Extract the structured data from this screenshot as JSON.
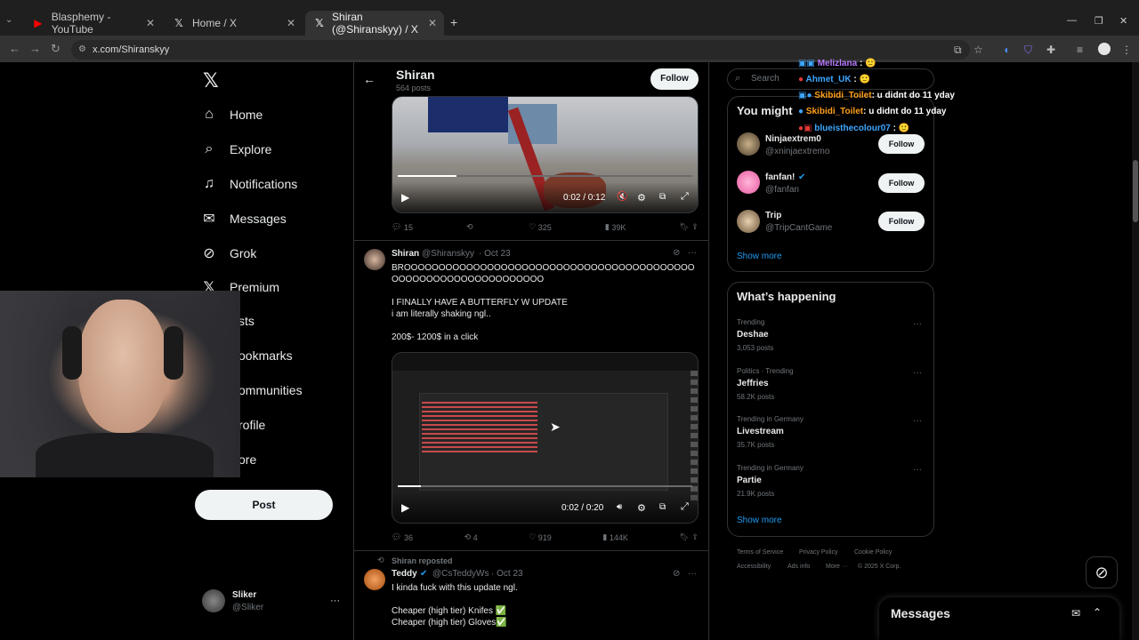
{
  "browser": {
    "tabs": [
      {
        "title": "Blasphemy - YouTube",
        "icon": "youtube-icon"
      },
      {
        "title": "Home / X",
        "icon": "x-logo-icon"
      },
      {
        "title": "Shiran (@Shiranskyy) / X",
        "icon": "x-logo-icon"
      }
    ],
    "url": "x.com/Shiranskyy",
    "new_tab": "+"
  },
  "nav": {
    "items": [
      "Home",
      "Explore",
      "Notifications",
      "Messages",
      "Grok",
      "Premium",
      "sts",
      "ookmarks",
      "ommunities",
      "rofile",
      "ore"
    ],
    "post_label": "Post",
    "account_name": "Sliker",
    "account_handle": "@Sliker"
  },
  "profile_header": {
    "name": "Shiran",
    "posts": "564 posts",
    "follow_label": "Follow"
  },
  "tweets": [
    {
      "video_time": "0:02 / 0:12",
      "video_progress": 0.2,
      "replies": "15",
      "retweets": "",
      "likes": "325",
      "views": "39K"
    },
    {
      "author": "Shiran",
      "handle": "@Shiranskyy",
      "date": "· Oct 23",
      "text": "BROOOOOOOOOOOOOOOOOOOOOOOOOOOOOOOOOOOOOOOOOOOOOOOOOOOOOOOOOOOOOOOO\n\nI FINALLY HAVE A BUTTERFLY W UPDATE\ni am literally shaking ngl..\n\n200$- 1200$ in a click",
      "video_time": "0:02 / 0:20",
      "video_progress": 0.08,
      "replies": "36",
      "retweets": "4",
      "likes": "919",
      "views": "144K"
    },
    {
      "repost_label": "Shiran reposted",
      "author": "Teddy",
      "handle": "@CsTeddyWs",
      "date": "· Oct 23",
      "text": "I kinda fuck with this update ngl.\n\nCheaper (high tier) Knifes ✅\nCheaper (high tier) Gloves✅"
    }
  ],
  "search": {
    "placeholder": "Search"
  },
  "who_to_follow": {
    "title": "You might",
    "users": [
      {
        "name": "Ninjaextrem0",
        "handle": "@xninjaextremo"
      },
      {
        "name": "fanfan!",
        "handle": "@fanfan"
      },
      {
        "name": "Trip",
        "handle": "@TripCantGame"
      }
    ],
    "follow_label": "Follow",
    "show_more": "Show more"
  },
  "whats_happening": {
    "title": "What’s happening",
    "trends": [
      {
        "meta": "Trending",
        "name": "Deshae",
        "count": "3,053 posts"
      },
      {
        "meta": "Politics · Trending",
        "name": "Jeffries",
        "count": "58.2K posts"
      },
      {
        "meta": "Trending in Germany",
        "name": "Livestream",
        "count": "35.7K posts"
      },
      {
        "meta": "Trending in Germany",
        "name": "Partie",
        "count": "21.9K posts"
      }
    ],
    "show_more": "Show more"
  },
  "footer": {
    "links": [
      "Terms of Service",
      "Privacy Policy",
      "Cookie Policy",
      "Accessibility",
      "Ads info",
      "More ···",
      "© 2025 X Corp."
    ]
  },
  "chat_overlay": [
    {
      "user": "Melizlana",
      "message": ":",
      "color": "#b77bff"
    },
    {
      "user": "Ahmet_UK",
      "message": ":",
      "color": "#3ea6ff"
    },
    {
      "user": "Skibidi_Toilet",
      "message": ": u didnt do 11 yday",
      "color": "#ff9f1a"
    },
    {
      "user": "Skibidi_Toilet",
      "message": ": u didnt do 11 yday",
      "color": "#ff9f1a"
    },
    {
      "user": "blueisthecolour07",
      "message": ":",
      "color": "#3ea6ff"
    }
  ],
  "messages_drawer": {
    "title": "Messages"
  },
  "colors": {
    "accent": "#1d9bf0",
    "background": "#000000",
    "border": "#2f3336",
    "muted": "#71767b"
  }
}
